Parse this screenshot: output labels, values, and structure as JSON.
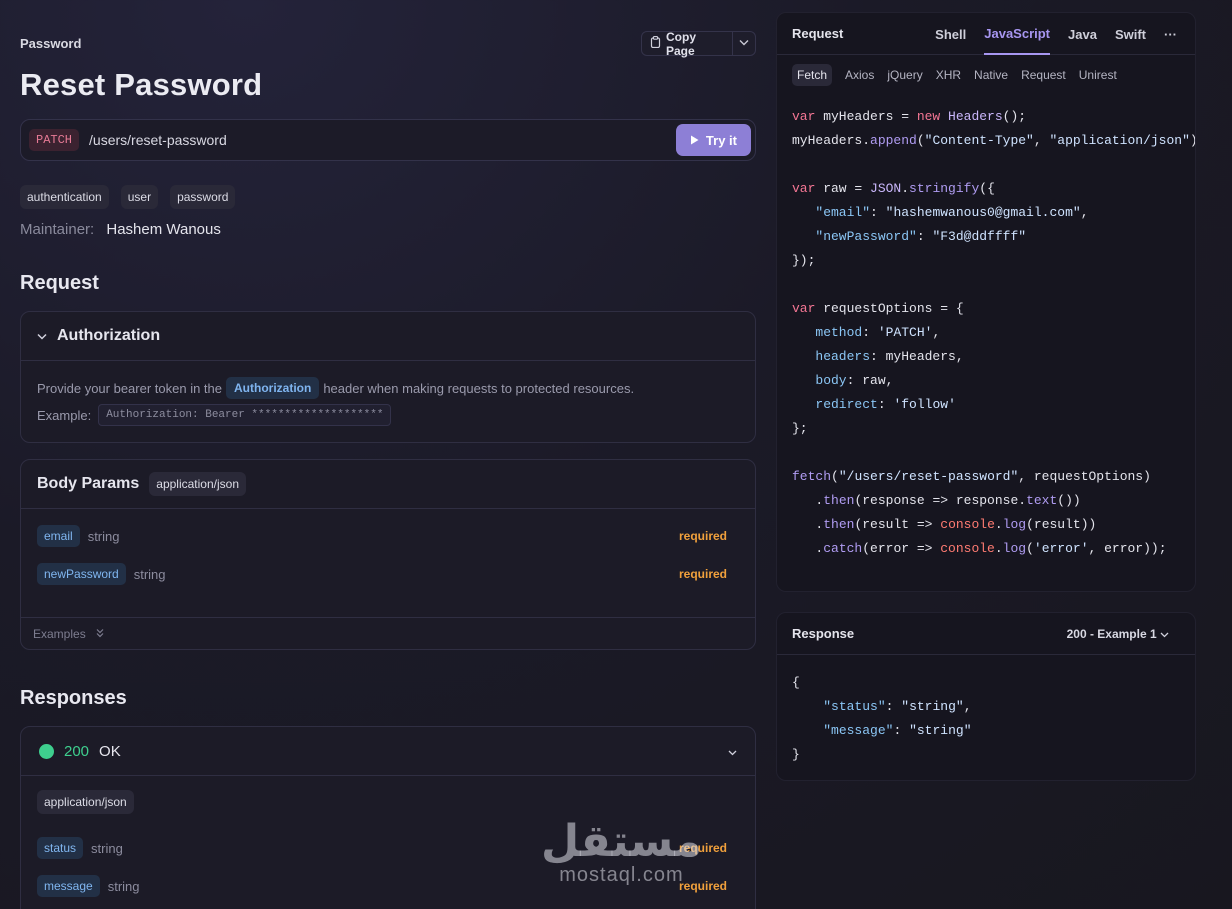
{
  "breadcrumb": "Password",
  "copy_page": "Copy Page",
  "title": "Reset Password",
  "endpoint": {
    "method": "PATCH",
    "path": "/users/reset-password",
    "try_label": "Try it"
  },
  "tags": [
    "authentication",
    "user",
    "password"
  ],
  "maintainer": {
    "label": "Maintainer:",
    "name": "Hashem Wanous"
  },
  "request_heading": "Request",
  "authorization": {
    "title": "Authorization",
    "desc_pre": "Provide your bearer token in the",
    "header_name": "Authorization",
    "desc_post": "header when making requests to protected resources.",
    "example_label": "Example:",
    "example_value": "Authorization: Bearer ********************"
  },
  "body_params": {
    "title": "Body Params",
    "content_type": "application/json",
    "params": [
      {
        "name": "email",
        "type": "string",
        "required": "required"
      },
      {
        "name": "newPassword",
        "type": "string",
        "required": "required"
      }
    ],
    "examples_label": "Examples"
  },
  "responses_heading": "Responses",
  "response_200": {
    "code": "200",
    "status": "OK",
    "content_type": "application/json",
    "fields": [
      {
        "name": "status",
        "type": "string",
        "required": "required"
      },
      {
        "name": "message",
        "type": "string",
        "required": "required"
      }
    ]
  },
  "code_panel": {
    "title": "Request",
    "languages": [
      "Shell",
      "JavaScript",
      "Java",
      "Swift"
    ],
    "active_language": "JavaScript",
    "more": "···",
    "libraries": [
      "Fetch",
      "Axios",
      "jQuery",
      "XHR",
      "Native",
      "Request",
      "Unirest"
    ],
    "active_library": "Fetch",
    "email": "hashemwanous0@gmail.com",
    "new_password": "F3d@ddffff",
    "method": "PATCH",
    "url": "/users/reset-password",
    "redirect": "follow"
  },
  "response_panel": {
    "title": "Response",
    "selector": "200 - Example 1",
    "status_key": "status",
    "status_val": "string",
    "message_key": "message",
    "message_val": "string"
  },
  "watermark": {
    "arabic": "مستقل",
    "latin": "mostaql.com"
  },
  "colors": {
    "accent": "#8d7fd6",
    "success": "#3ecf8e",
    "required": "#f0a03c",
    "method": "#e67a95"
  }
}
